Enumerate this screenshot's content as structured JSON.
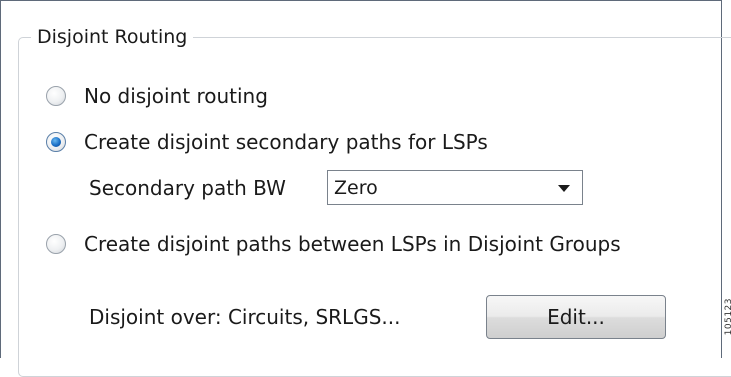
{
  "group": {
    "title": "Disjoint Routing"
  },
  "options": {
    "no_disjoint": {
      "label": "No disjoint routing",
      "checked": false
    },
    "secondary_paths": {
      "label": "Create disjoint secondary paths for LSPs",
      "checked": true
    },
    "disjoint_groups": {
      "label": "Create disjoint paths between LSPs in Disjoint Groups",
      "checked": false
    }
  },
  "secondary_bw": {
    "label": "Secondary path BW",
    "selected": "Zero"
  },
  "disjoint_over": {
    "label": "Disjoint over: Circuits, SRLGS...",
    "edit_button": "Edit..."
  },
  "figure_code": "105123"
}
